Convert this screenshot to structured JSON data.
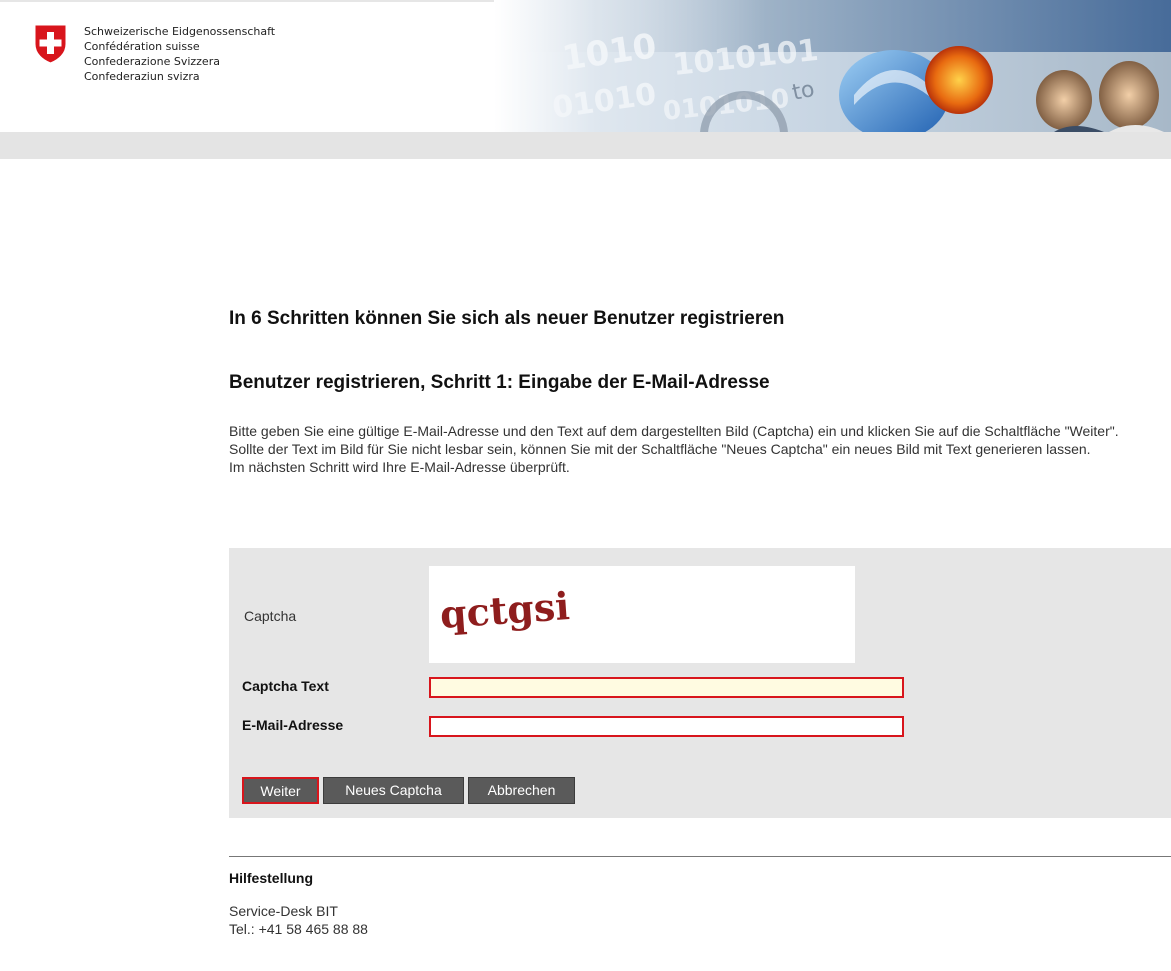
{
  "header": {
    "confederation_names": [
      "Schweizerische Eidgenossenschaft",
      "Confédération suisse",
      "Confederazione Svizzera",
      "Confederaziun svizra"
    ],
    "banner_text": "to",
    "banner_digits": [
      "1010",
      "1010101",
      "01010",
      "0101010"
    ]
  },
  "main": {
    "title": "In 6 Schritten können Sie sich als neuer Benutzer registrieren",
    "step_title": "Benutzer registrieren, Schritt 1: Eingabe der E-Mail-Adresse",
    "instructions": [
      "Bitte geben Sie eine gültige E-Mail-Adresse und den Text auf dem dargestellten Bild (Captcha) ein und klicken Sie auf die Schaltfläche \"Weiter\".",
      "Sollte der Text im Bild für Sie nicht lesbar sein, können Sie mit der Schaltfläche \"Neues Captcha\" ein neues Bild mit Text generieren lassen.",
      "Im nächsten Schritt wird Ihre E-Mail-Adresse überprüft."
    ]
  },
  "form": {
    "captcha_label": "Captcha",
    "captcha_image_text": "qctgsi",
    "captcha_text_label": "Captcha Text",
    "captcha_text_value": "",
    "email_label": "E-Mail-Adresse",
    "email_value": ""
  },
  "buttons": {
    "weiter": "Weiter",
    "neues_captcha": "Neues Captcha",
    "abbrechen": "Abbrechen"
  },
  "help": {
    "title": "Hilfestellung",
    "desk": "Service-Desk BIT",
    "tel": "Tel.: +41 58 465 88 88"
  },
  "colors": {
    "swiss_red": "#d8151c",
    "panel_gray": "#e6e6e6",
    "button_gray": "#5a5a5a",
    "captcha_input_bg": "#fffbe1"
  }
}
